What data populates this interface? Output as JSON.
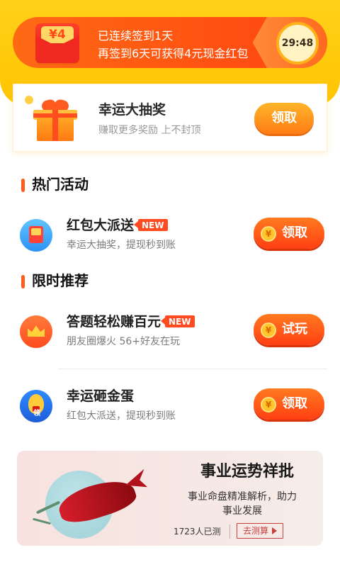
{
  "signin": {
    "reward_badge": "¥4",
    "line1_prefix": "已连续签到",
    "line1_count": "1",
    "line1_suffix": "天",
    "line2": "再签到6天可获得4元现金红包",
    "timer": "29:48"
  },
  "lucky": {
    "title": "幸运大抽奖",
    "subtitle": "赚取更多奖励 上不封顶",
    "button": "领取"
  },
  "sections": {
    "hot": "热门活动",
    "recommend": "限时推荐"
  },
  "activities": [
    {
      "name": "红包大派送",
      "tag": "NEW",
      "desc": "幸运大抽奖，提现秒到账",
      "button": "领取",
      "coin_symbol": "¥"
    },
    {
      "name": "答题轻松赚百元",
      "tag": "NEW",
      "desc": "朋友圈爆火 56+好友在玩",
      "button": "试玩",
      "coin_symbol": "¥"
    },
    {
      "name": "幸运砸金蛋",
      "desc": "红包大派送，提现秒到账",
      "button": "领取",
      "coin_symbol": "¥",
      "icon_label": "领"
    }
  ],
  "career": {
    "title": "事业运势祥批",
    "desc_line1": "事业命盘精准解析，助力",
    "desc_line2": "事业发展",
    "count": "1723人已测",
    "button": "去测算"
  }
}
